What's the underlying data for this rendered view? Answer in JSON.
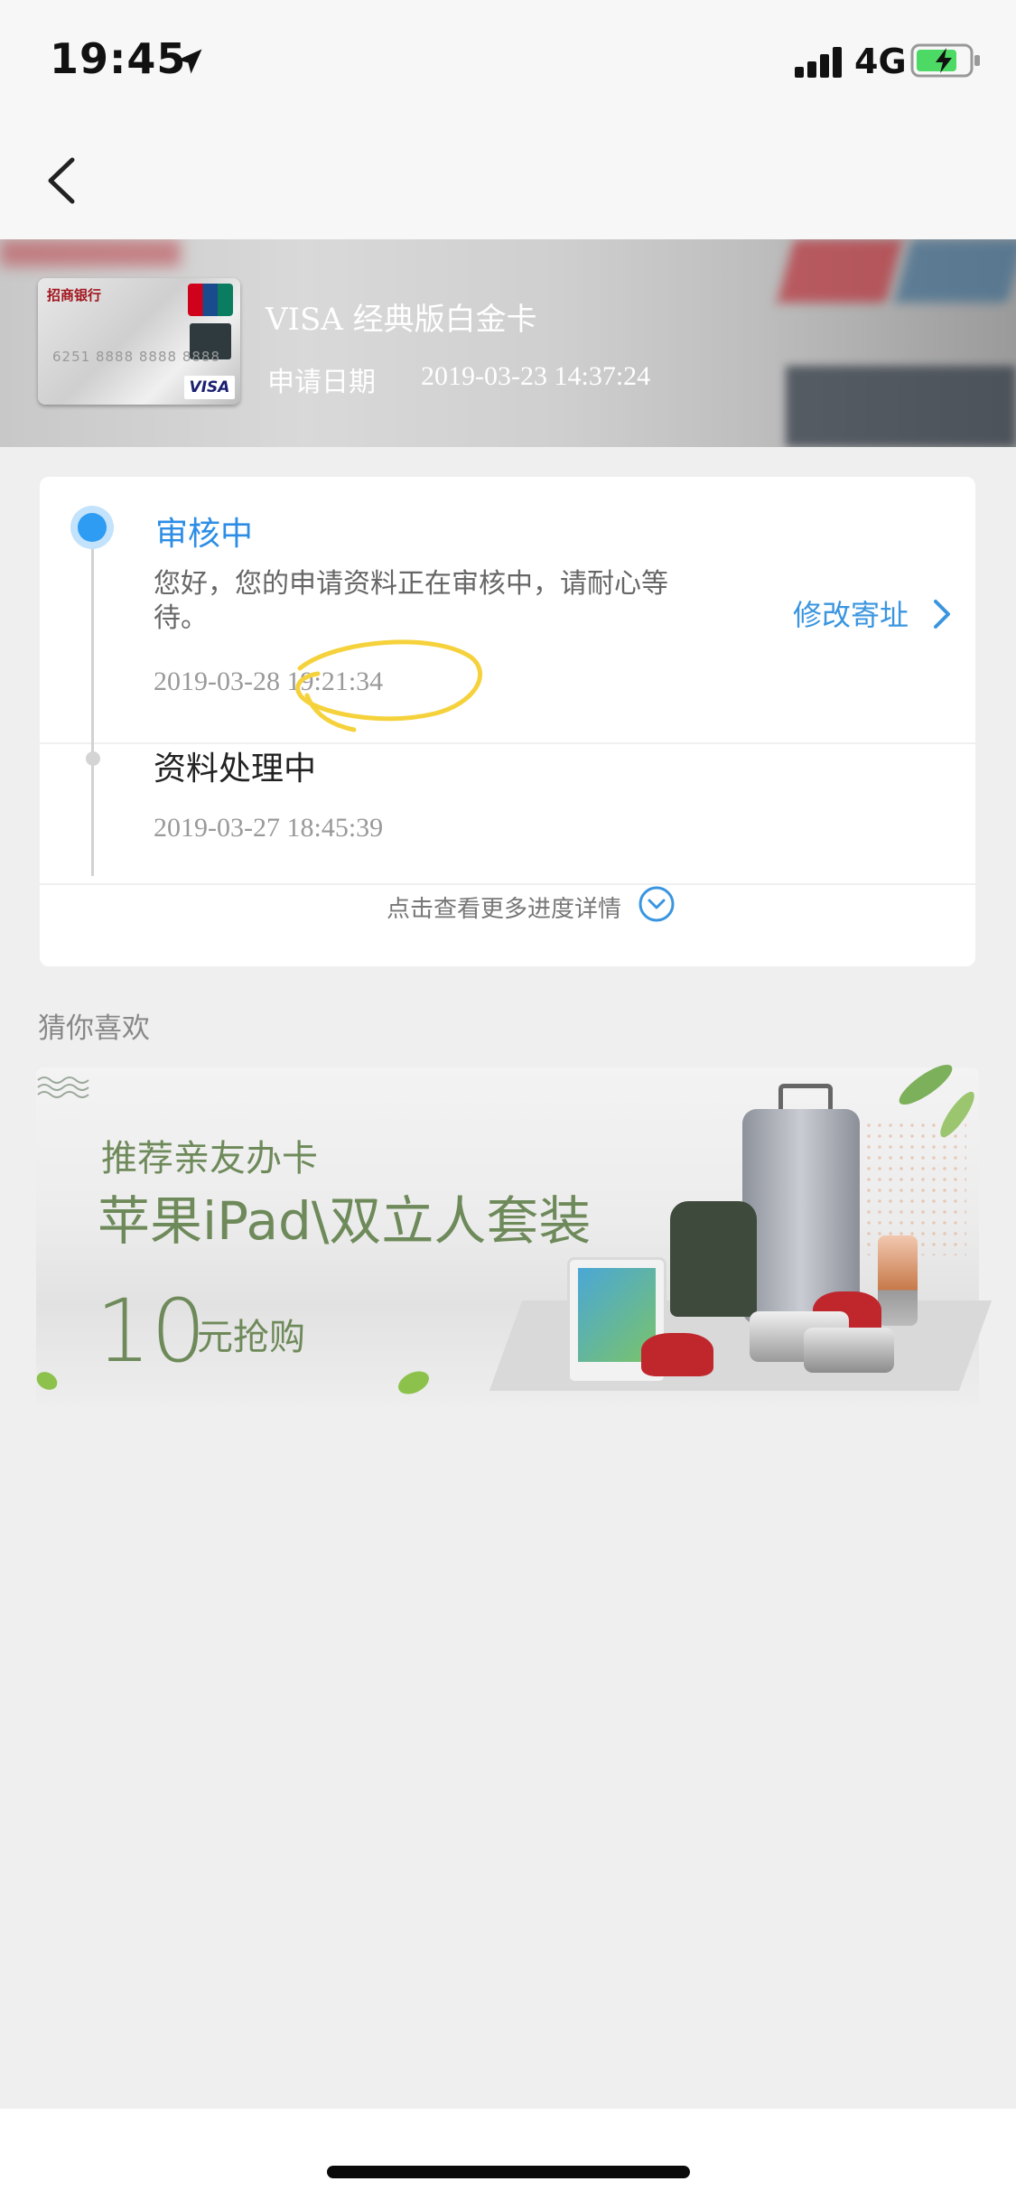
{
  "status_bar": {
    "time": "19:45",
    "network": "4G"
  },
  "nav": {
    "back_label": ""
  },
  "card": {
    "name": "VISA 经典版白金卡",
    "apply_label": "申请日期",
    "apply_date": "2019-03-23 14:37:24",
    "bank_text": "招商银行",
    "card_number": "6251 8888 8888 8888",
    "network_logo": "VISA"
  },
  "progress": {
    "steps": [
      {
        "title": "审核中",
        "description": "您好，您的申请资料正在审核中，请耐心等待。",
        "time": "2019-03-28 19:21:34",
        "status": "active"
      },
      {
        "title": "资料处理中",
        "time": "2019-03-27 18:45:39",
        "status": "done"
      }
    ],
    "edit_link": "修改寄址",
    "more_link": "点击查看更多进度详情"
  },
  "recommend": {
    "section_title": "猜你喜欢",
    "banner": {
      "line1": "推荐亲友办卡",
      "line2": "苹果iPad\\双立人套装",
      "price": "10",
      "price_unit": "元抢购"
    }
  },
  "colors": {
    "accent": "#2d8de6",
    "link": "#3a95e0",
    "banner_text": "#6e8a5a",
    "annotation": "#f5d23c"
  }
}
